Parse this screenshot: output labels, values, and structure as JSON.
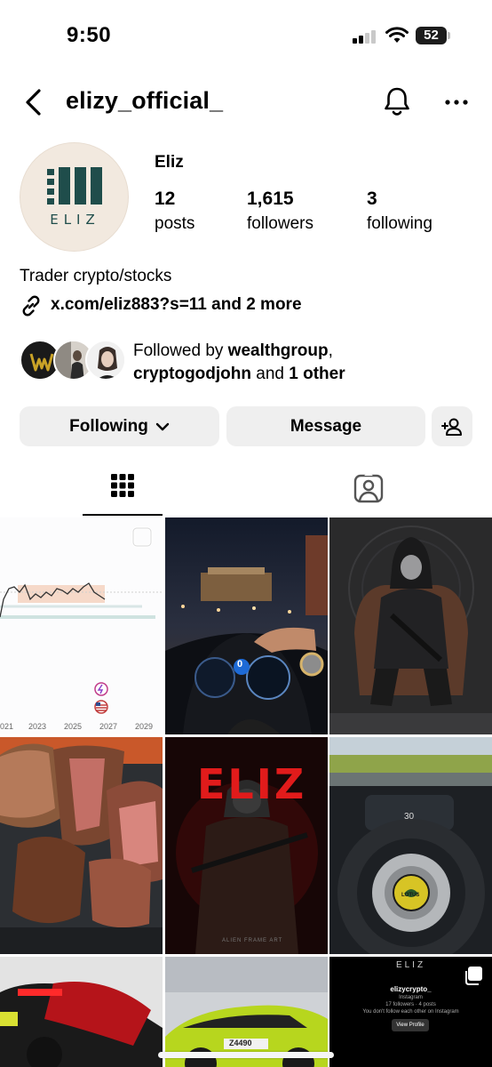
{
  "status_bar": {
    "time": "9:50",
    "battery": "52"
  },
  "header": {
    "username": "elizy_official_"
  },
  "profile": {
    "display_name": "Eliz",
    "avatar_text": "ELIZ",
    "stats": [
      {
        "value": "12",
        "label": "posts"
      },
      {
        "value": "1,615",
        "label": "followers"
      },
      {
        "value": "3",
        "label": "following"
      }
    ],
    "bio": "Trader crypto/stocks",
    "link": "x.com/eliz883?s=11 and 2 more"
  },
  "followed_by": {
    "prefix": "Followed by ",
    "user1": "wealthgroup",
    "sep": ",",
    "user2": "cryptogodjohn",
    "middle": " and ",
    "others": "1 other"
  },
  "actions": {
    "following": "Following",
    "message": "Message"
  },
  "tabs": [
    {
      "name": "posts-grid",
      "icon": "grid-icon"
    },
    {
      "name": "tagged",
      "icon": "person-tag-icon"
    }
  ],
  "posts": {
    "chart_years": [
      "021",
      "2023",
      "2025",
      "2027",
      "2029"
    ],
    "dash_speed": "0",
    "poster_text": "ELIZ",
    "poster_caption": "ALIEN FRAME ART",
    "lotus_badge": "LOTUS",
    "lotus_speed": "30",
    "car_plate": "Z4490",
    "shared_profile": {
      "logo": "ELIZ",
      "name": "elizycrypto_",
      "platform": "Instagram",
      "meta": "17 followers · 4 posts",
      "note": "You don't follow each other on Instagram",
      "button": "View Profile"
    }
  }
}
